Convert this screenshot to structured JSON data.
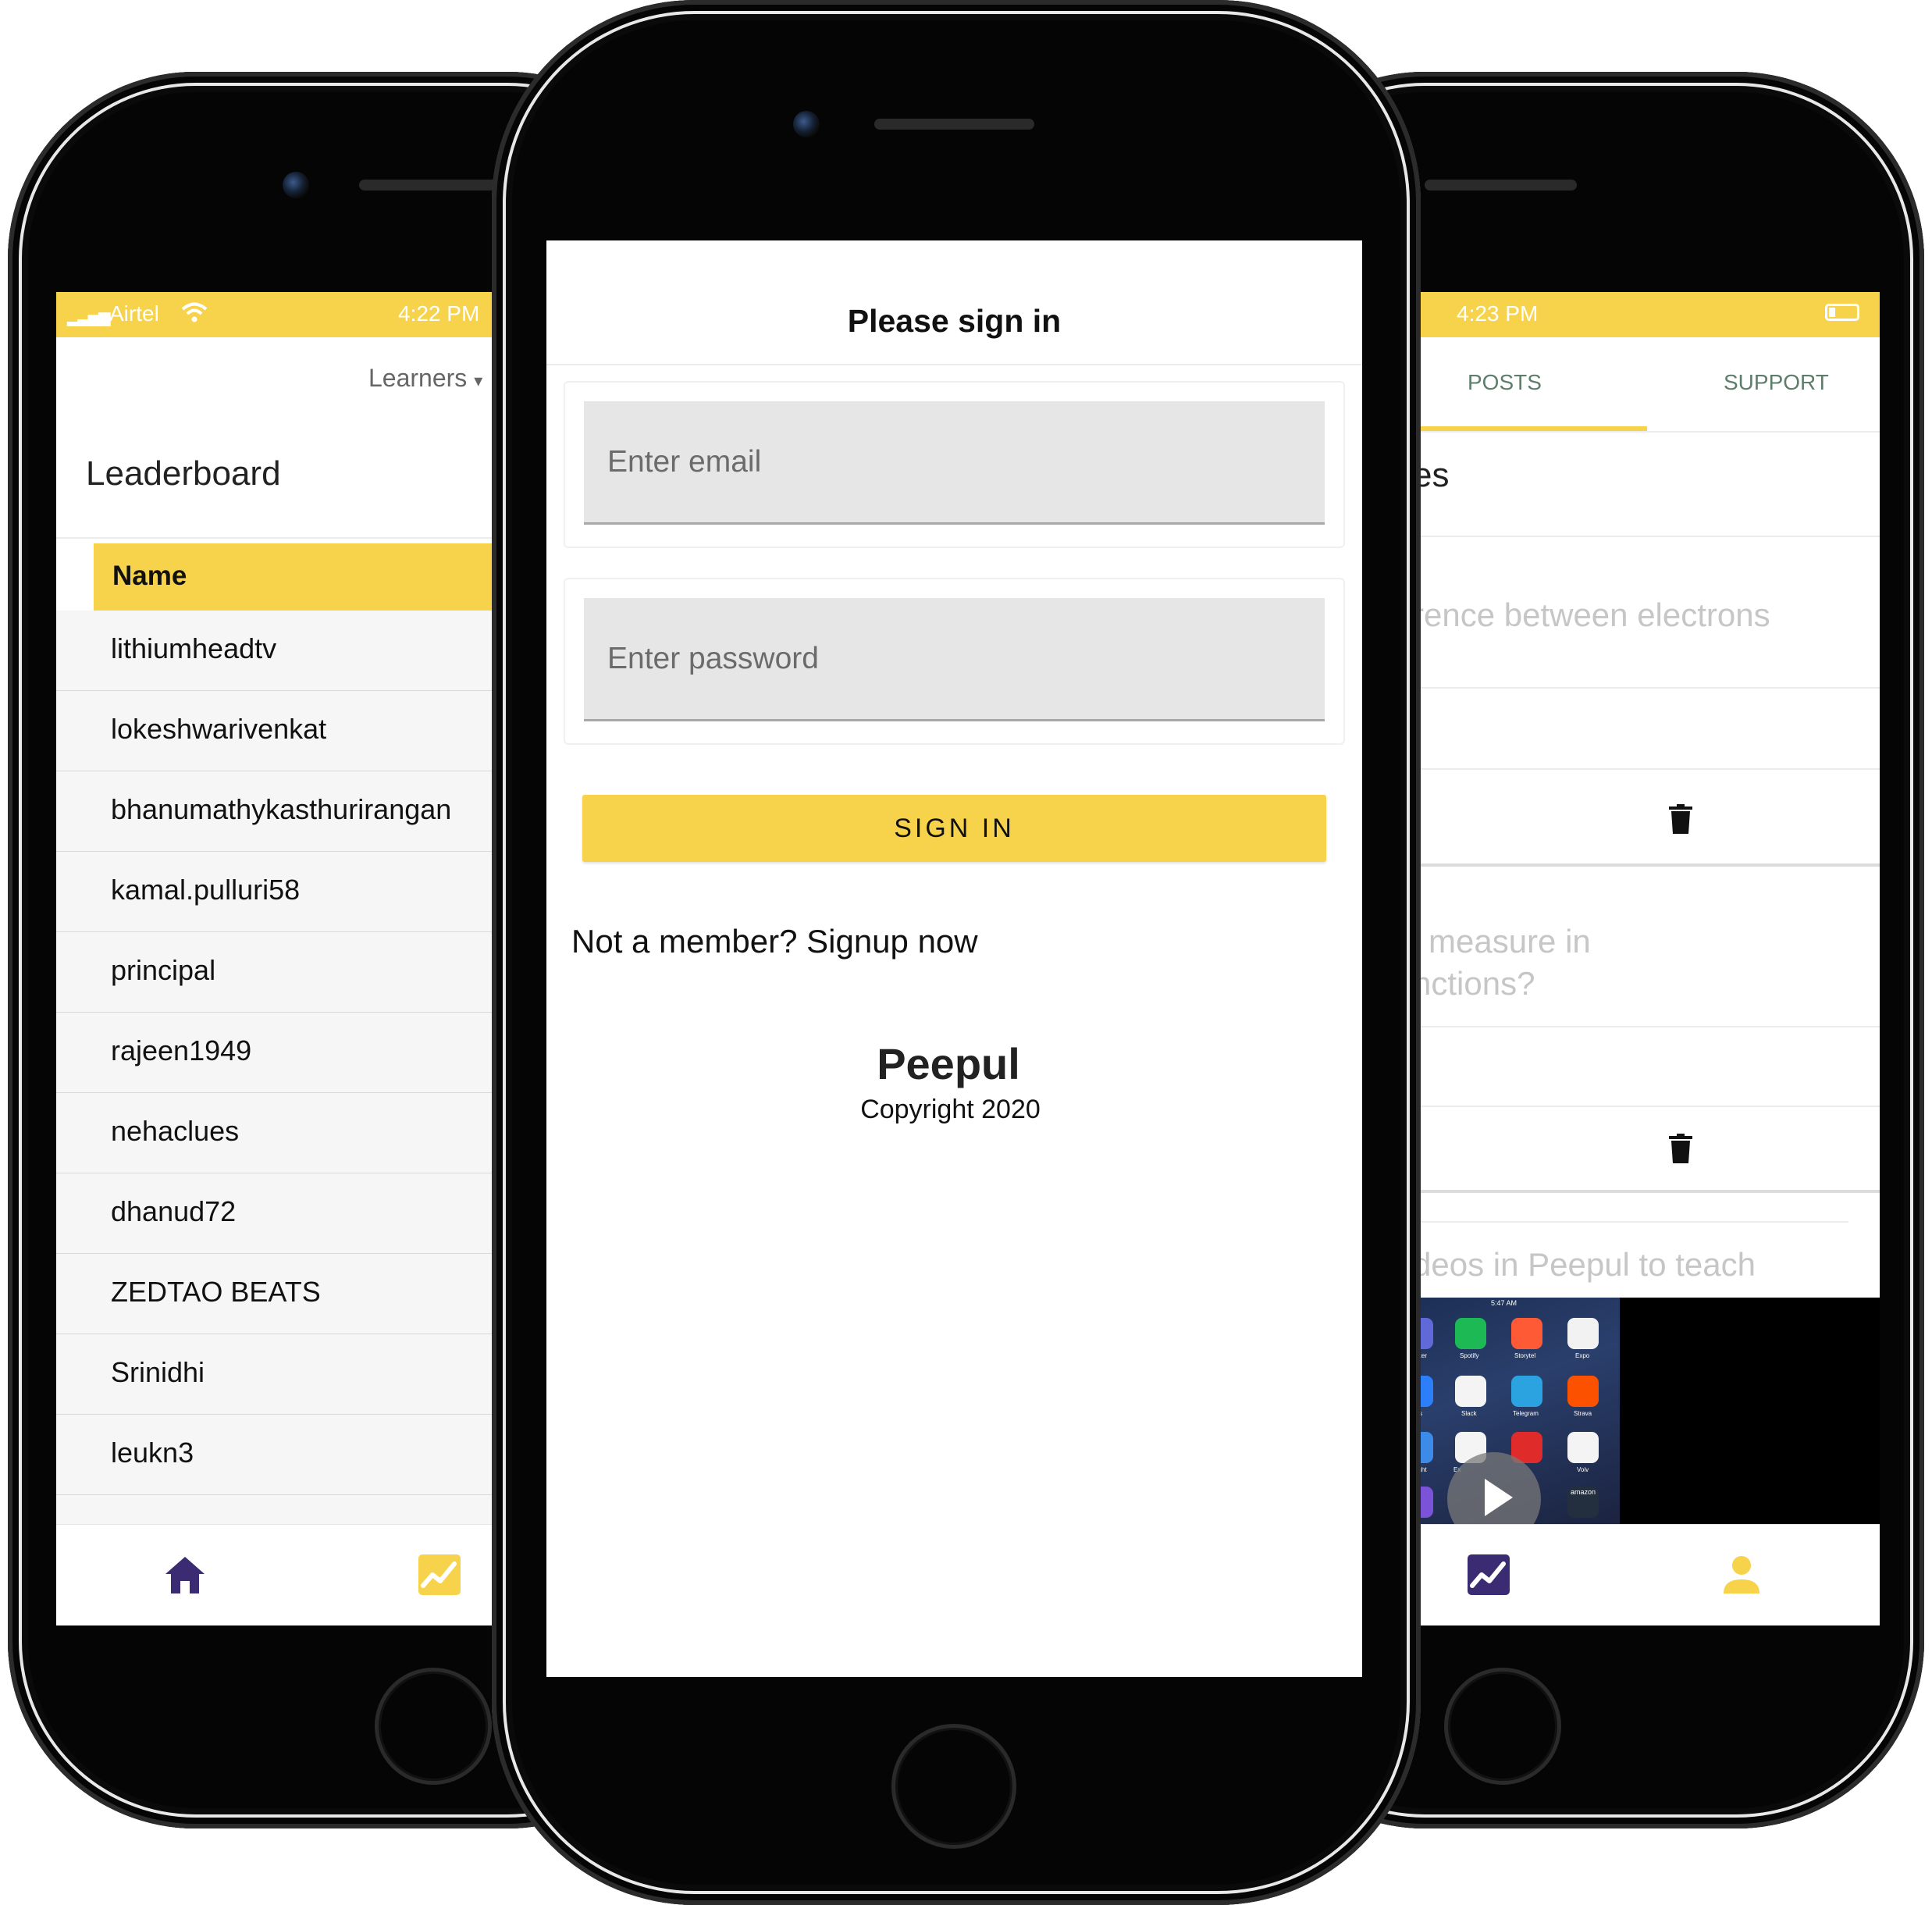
{
  "left_phone": {
    "status": {
      "carrier": "Airtel",
      "time": "4:22 PM"
    },
    "dropdown_label": "Learners",
    "title": "Leaderboard",
    "table_header": "Name",
    "rows": [
      "lithiumheadtv",
      "lokeshwarivenkat",
      "bhanumathykasthurirangan",
      "kamal.pulluri58",
      "principal",
      "rajeen1949",
      "nehaclues",
      "dhanud72",
      "ZEDTAO BEATS",
      "Srinidhi",
      "leukn3"
    ],
    "tabs": [
      "home-icon",
      "chart-icon"
    ]
  },
  "center_phone": {
    "title": "Please sign in",
    "email_placeholder": "Enter email",
    "password_placeholder": "Enter password",
    "signin_label": "SIGN IN",
    "signup_text": "Not a member? Signup now",
    "brand": "Peepul",
    "copyright": "Copyright 2020"
  },
  "right_phone": {
    "status": {
      "time": "4:23 PM"
    },
    "tabs": [
      "POSTS",
      "SUPPORT"
    ],
    "heading_fragment": "es",
    "post1_fragment": "rence between electrons",
    "post2_line1": "measure in",
    "post2_line2": "nctions?",
    "post3_fragment": "deos in Peepul to teach",
    "app_labels": [
      "Locker",
      "Spotify",
      "Storytel",
      "Expo",
      "ells",
      "Slack",
      "Telegram",
      "Strava",
      "Flight",
      "Ex",
      "",
      "Voiv",
      "",
      "",
      "",
      "amazon"
    ],
    "video_time": "5:47 AM",
    "bottom_tabs": [
      "chart-icon",
      "user-icon"
    ]
  },
  "colors": {
    "accent_yellow": "#f6d34a",
    "icon_purple": "#3a2b73",
    "tab_text": "#5f7d6b"
  }
}
